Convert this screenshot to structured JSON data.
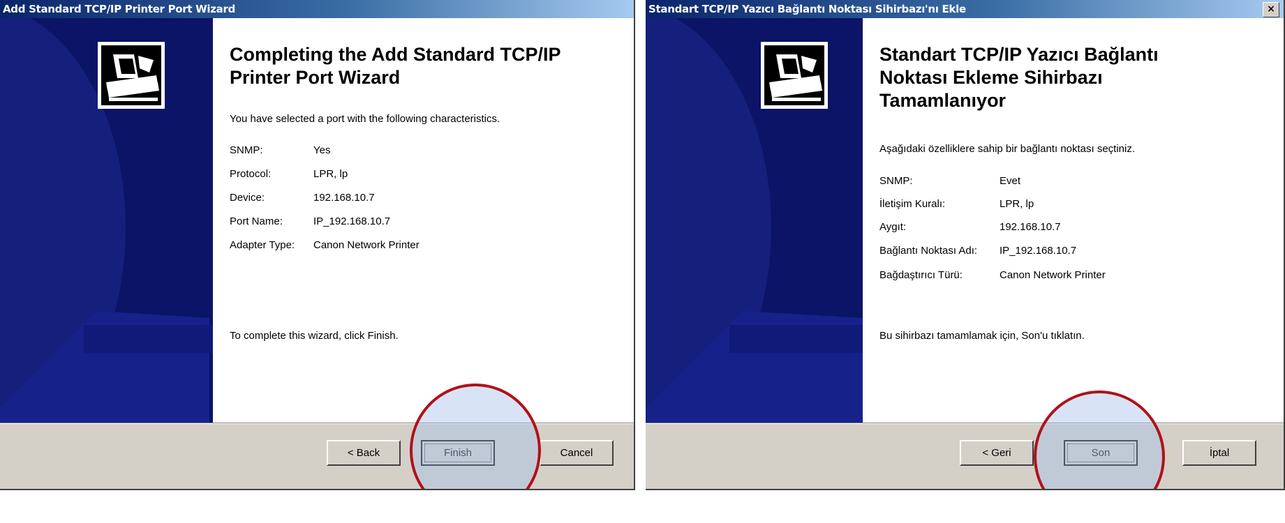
{
  "left_window": {
    "title": "Add Standard TCP/IP Printer Port Wizard",
    "heading": "Completing the Add Standard TCP/IP Printer Port Wizard",
    "intro": "You have selected a port with the following characteristics.",
    "properties": [
      {
        "label": "SNMP:",
        "value": "Yes"
      },
      {
        "label": "Protocol:",
        "value": "LPR, lp"
      },
      {
        "label": "Device:",
        "value": "192.168.10.7"
      },
      {
        "label": "Port Name:",
        "value": "IP_192.168.10.7"
      },
      {
        "label": "Adapter Type:",
        "value": "Canon Network Printer"
      }
    ],
    "footer": "To complete this wizard, click Finish.",
    "buttons": {
      "back": "< Back",
      "finish": "Finish",
      "cancel": "Cancel"
    }
  },
  "right_window": {
    "title": "Standart TCP/IP Yazıcı Bağlantı Noktası Sihirbazı'nı Ekle",
    "close_label": "×",
    "heading": "Standart TCP/IP Yazıcı Bağlantı Noktası Ekleme Sihirbazı Tamamlanıyor",
    "intro": "Aşağıdaki özelliklere sahip bir bağlantı noktası seçtiniz.",
    "properties": [
      {
        "label": "SNMP:",
        "value": "Evet"
      },
      {
        "label": "İletişim Kuralı:",
        "value": "LPR, lp"
      },
      {
        "label": "Aygıt:",
        "value": "192.168.10.7"
      },
      {
        "label": "Bağlantı Noktası Adı:",
        "value": "IP_192.168.10.7"
      },
      {
        "label": "Bağdaştırıcı Türü:",
        "value": "Canon Network Printer"
      }
    ],
    "footer": "Bu sihirbazı tamamlamak için, Son'u tıklatın.",
    "buttons": {
      "back": "< Geri",
      "finish": "Son",
      "cancel": "İptal"
    }
  },
  "colors": {
    "titlebar": "#0a246a",
    "sidebar": "#0b1466",
    "callout": "#b01218"
  },
  "icons": [
    "wizard-printer-icon",
    "close-icon"
  ]
}
